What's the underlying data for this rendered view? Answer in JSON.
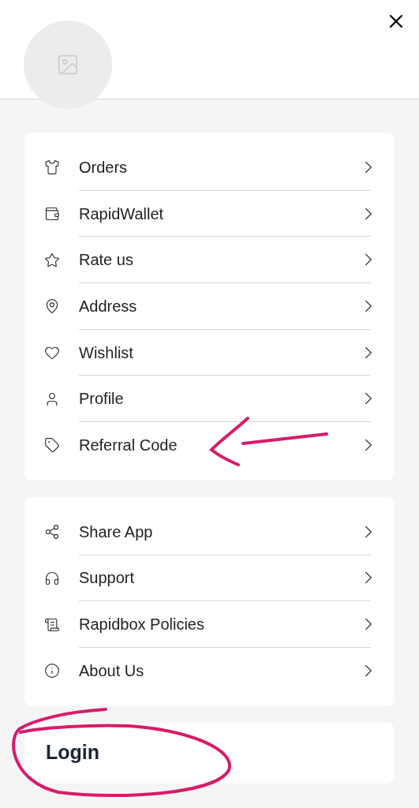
{
  "menu_groups": [
    {
      "items": [
        {
          "label": "Orders"
        },
        {
          "label": "RapidWallet"
        },
        {
          "label": "Rate us"
        },
        {
          "label": "Address"
        },
        {
          "label": "Wishlist"
        },
        {
          "label": "Profile"
        },
        {
          "label": "Referral Code"
        }
      ]
    },
    {
      "items": [
        {
          "label": "Share App"
        },
        {
          "label": "Support"
        },
        {
          "label": "Rapidbox Policies"
        },
        {
          "label": "About Us"
        }
      ]
    }
  ],
  "login": {
    "label": "Login"
  }
}
